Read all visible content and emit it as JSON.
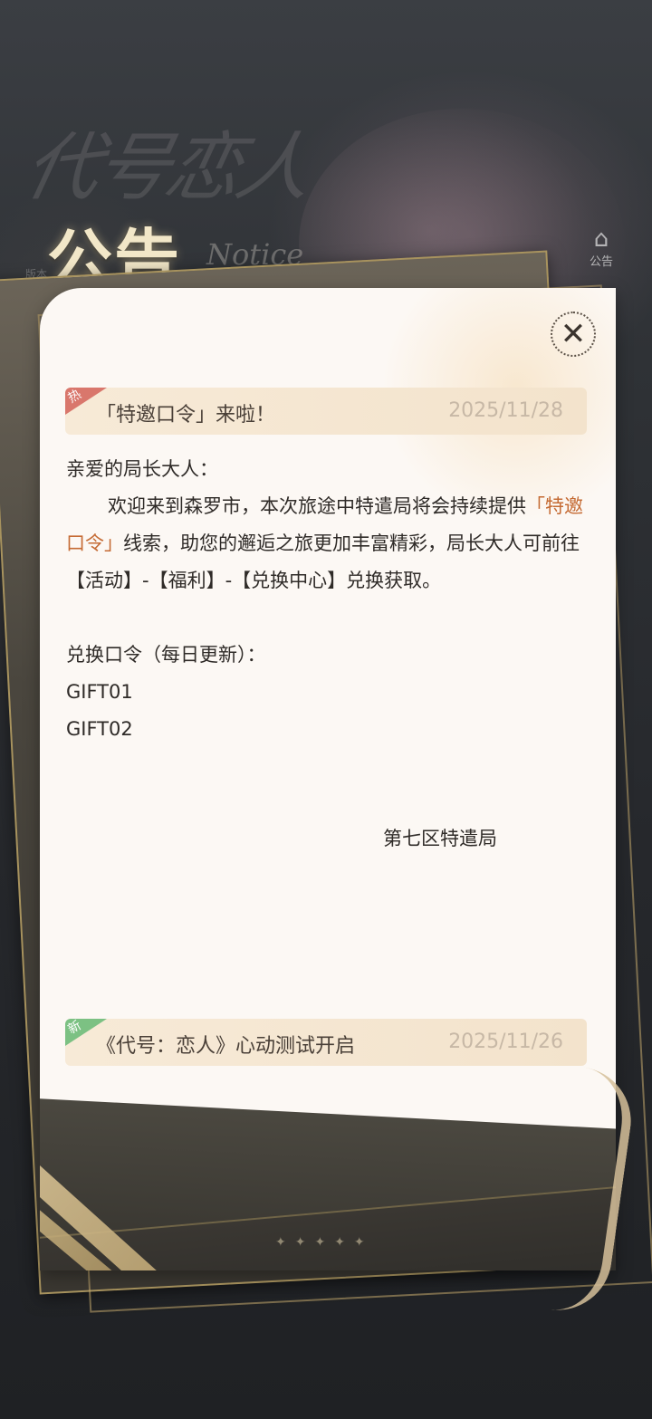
{
  "header": {
    "game_logo": "代号恋人",
    "title": "公告",
    "title_en": "Notice",
    "version": "版本",
    "side_notice_label": "公告"
  },
  "notices": [
    {
      "tag": "热",
      "tag_color": "#d9776c",
      "title": "「特邀口令」来啦！",
      "date": "2025/11/28"
    },
    {
      "tag": "新",
      "tag_color": "#7cc183",
      "title": "《代号：恋人》心动测试开启",
      "date": "2025/11/26"
    }
  ],
  "content": {
    "greeting": "亲爱的局长大人：",
    "para1_before": "欢迎来到森罗市，本次旅途中特遣局将会持续提供",
    "para1_highlight": "「特邀口令」",
    "para1_after": "线索，助您的邂逅之旅更加丰富精彩，局长大人可前往【活动】-【福利】-【兑换中心】兑换获取。",
    "codes_label": "兑换口令（每日更新）：",
    "codes": [
      "GIFT01",
      "GIFT02"
    ],
    "signature": "第七区特遣局"
  },
  "colors": {
    "highlight": "#c56b34",
    "card_bg": "#fcf8f4",
    "frame_gold": "#a8935e"
  },
  "icons": {
    "close": "close-x-icon"
  }
}
